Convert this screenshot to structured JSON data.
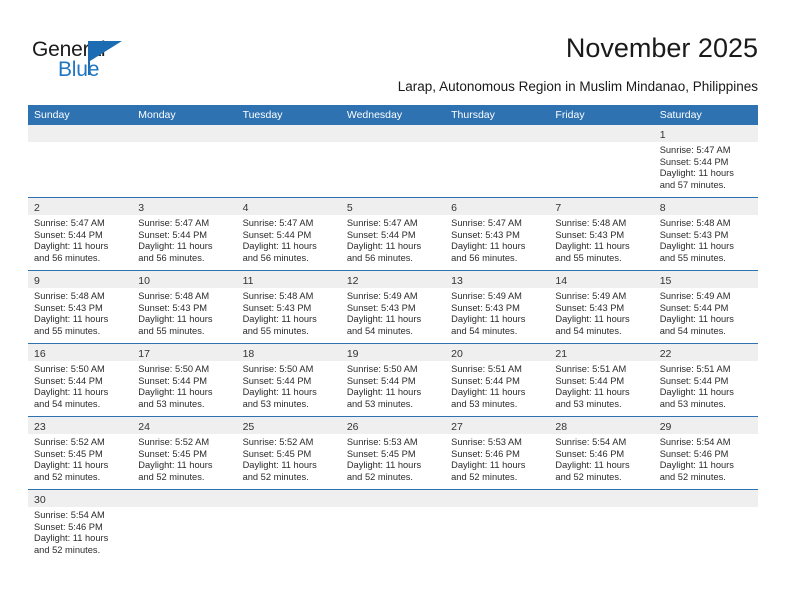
{
  "brand": {
    "name_part1": "General",
    "name_part2": "Blue"
  },
  "header": {
    "title": "November 2025",
    "location": "Larap, Autonomous Region in Muslim Mindanao, Philippines"
  },
  "colors": {
    "header_blue": "#2e72b2",
    "date_band_gray": "#efefef",
    "brand_blue": "#1f76c2"
  },
  "weekdays": [
    "Sunday",
    "Monday",
    "Tuesday",
    "Wednesday",
    "Thursday",
    "Friday",
    "Saturday"
  ],
  "weeks": [
    [
      {
        "empty": true
      },
      {
        "empty": true
      },
      {
        "empty": true
      },
      {
        "empty": true
      },
      {
        "empty": true
      },
      {
        "empty": true
      },
      {
        "day": "1",
        "sunrise": "Sunrise: 5:47 AM",
        "sunset": "Sunset: 5:44 PM",
        "daylight1": "Daylight: 11 hours",
        "daylight2": "and 57 minutes."
      }
    ],
    [
      {
        "day": "2",
        "sunrise": "Sunrise: 5:47 AM",
        "sunset": "Sunset: 5:44 PM",
        "daylight1": "Daylight: 11 hours",
        "daylight2": "and 56 minutes."
      },
      {
        "day": "3",
        "sunrise": "Sunrise: 5:47 AM",
        "sunset": "Sunset: 5:44 PM",
        "daylight1": "Daylight: 11 hours",
        "daylight2": "and 56 minutes."
      },
      {
        "day": "4",
        "sunrise": "Sunrise: 5:47 AM",
        "sunset": "Sunset: 5:44 PM",
        "daylight1": "Daylight: 11 hours",
        "daylight2": "and 56 minutes."
      },
      {
        "day": "5",
        "sunrise": "Sunrise: 5:47 AM",
        "sunset": "Sunset: 5:44 PM",
        "daylight1": "Daylight: 11 hours",
        "daylight2": "and 56 minutes."
      },
      {
        "day": "6",
        "sunrise": "Sunrise: 5:47 AM",
        "sunset": "Sunset: 5:43 PM",
        "daylight1": "Daylight: 11 hours",
        "daylight2": "and 56 minutes."
      },
      {
        "day": "7",
        "sunrise": "Sunrise: 5:48 AM",
        "sunset": "Sunset: 5:43 PM",
        "daylight1": "Daylight: 11 hours",
        "daylight2": "and 55 minutes."
      },
      {
        "day": "8",
        "sunrise": "Sunrise: 5:48 AM",
        "sunset": "Sunset: 5:43 PM",
        "daylight1": "Daylight: 11 hours",
        "daylight2": "and 55 minutes."
      }
    ],
    [
      {
        "day": "9",
        "sunrise": "Sunrise: 5:48 AM",
        "sunset": "Sunset: 5:43 PM",
        "daylight1": "Daylight: 11 hours",
        "daylight2": "and 55 minutes."
      },
      {
        "day": "10",
        "sunrise": "Sunrise: 5:48 AM",
        "sunset": "Sunset: 5:43 PM",
        "daylight1": "Daylight: 11 hours",
        "daylight2": "and 55 minutes."
      },
      {
        "day": "11",
        "sunrise": "Sunrise: 5:48 AM",
        "sunset": "Sunset: 5:43 PM",
        "daylight1": "Daylight: 11 hours",
        "daylight2": "and 55 minutes."
      },
      {
        "day": "12",
        "sunrise": "Sunrise: 5:49 AM",
        "sunset": "Sunset: 5:43 PM",
        "daylight1": "Daylight: 11 hours",
        "daylight2": "and 54 minutes."
      },
      {
        "day": "13",
        "sunrise": "Sunrise: 5:49 AM",
        "sunset": "Sunset: 5:43 PM",
        "daylight1": "Daylight: 11 hours",
        "daylight2": "and 54 minutes."
      },
      {
        "day": "14",
        "sunrise": "Sunrise: 5:49 AM",
        "sunset": "Sunset: 5:43 PM",
        "daylight1": "Daylight: 11 hours",
        "daylight2": "and 54 minutes."
      },
      {
        "day": "15",
        "sunrise": "Sunrise: 5:49 AM",
        "sunset": "Sunset: 5:44 PM",
        "daylight1": "Daylight: 11 hours",
        "daylight2": "and 54 minutes."
      }
    ],
    [
      {
        "day": "16",
        "sunrise": "Sunrise: 5:50 AM",
        "sunset": "Sunset: 5:44 PM",
        "daylight1": "Daylight: 11 hours",
        "daylight2": "and 54 minutes."
      },
      {
        "day": "17",
        "sunrise": "Sunrise: 5:50 AM",
        "sunset": "Sunset: 5:44 PM",
        "daylight1": "Daylight: 11 hours",
        "daylight2": "and 53 minutes."
      },
      {
        "day": "18",
        "sunrise": "Sunrise: 5:50 AM",
        "sunset": "Sunset: 5:44 PM",
        "daylight1": "Daylight: 11 hours",
        "daylight2": "and 53 minutes."
      },
      {
        "day": "19",
        "sunrise": "Sunrise: 5:50 AM",
        "sunset": "Sunset: 5:44 PM",
        "daylight1": "Daylight: 11 hours",
        "daylight2": "and 53 minutes."
      },
      {
        "day": "20",
        "sunrise": "Sunrise: 5:51 AM",
        "sunset": "Sunset: 5:44 PM",
        "daylight1": "Daylight: 11 hours",
        "daylight2": "and 53 minutes."
      },
      {
        "day": "21",
        "sunrise": "Sunrise: 5:51 AM",
        "sunset": "Sunset: 5:44 PM",
        "daylight1": "Daylight: 11 hours",
        "daylight2": "and 53 minutes."
      },
      {
        "day": "22",
        "sunrise": "Sunrise: 5:51 AM",
        "sunset": "Sunset: 5:44 PM",
        "daylight1": "Daylight: 11 hours",
        "daylight2": "and 53 minutes."
      }
    ],
    [
      {
        "day": "23",
        "sunrise": "Sunrise: 5:52 AM",
        "sunset": "Sunset: 5:45 PM",
        "daylight1": "Daylight: 11 hours",
        "daylight2": "and 52 minutes."
      },
      {
        "day": "24",
        "sunrise": "Sunrise: 5:52 AM",
        "sunset": "Sunset: 5:45 PM",
        "daylight1": "Daylight: 11 hours",
        "daylight2": "and 52 minutes."
      },
      {
        "day": "25",
        "sunrise": "Sunrise: 5:52 AM",
        "sunset": "Sunset: 5:45 PM",
        "daylight1": "Daylight: 11 hours",
        "daylight2": "and 52 minutes."
      },
      {
        "day": "26",
        "sunrise": "Sunrise: 5:53 AM",
        "sunset": "Sunset: 5:45 PM",
        "daylight1": "Daylight: 11 hours",
        "daylight2": "and 52 minutes."
      },
      {
        "day": "27",
        "sunrise": "Sunrise: 5:53 AM",
        "sunset": "Sunset: 5:46 PM",
        "daylight1": "Daylight: 11 hours",
        "daylight2": "and 52 minutes."
      },
      {
        "day": "28",
        "sunrise": "Sunrise: 5:54 AM",
        "sunset": "Sunset: 5:46 PM",
        "daylight1": "Daylight: 11 hours",
        "daylight2": "and 52 minutes."
      },
      {
        "day": "29",
        "sunrise": "Sunrise: 5:54 AM",
        "sunset": "Sunset: 5:46 PM",
        "daylight1": "Daylight: 11 hours",
        "daylight2": "and 52 minutes."
      }
    ],
    [
      {
        "day": "30",
        "sunrise": "Sunrise: 5:54 AM",
        "sunset": "Sunset: 5:46 PM",
        "daylight1": "Daylight: 11 hours",
        "daylight2": "and 52 minutes."
      },
      {
        "empty": true
      },
      {
        "empty": true
      },
      {
        "empty": true
      },
      {
        "empty": true
      },
      {
        "empty": true
      },
      {
        "empty": true
      }
    ]
  ]
}
